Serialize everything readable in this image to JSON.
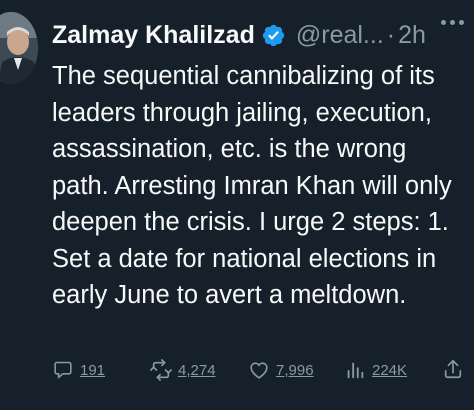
{
  "author": {
    "display_name": "Zalmay Khalilzad",
    "handle": "@real...",
    "separator": "·",
    "time": "2h",
    "verified_icon": "verified-badge-icon"
  },
  "tweet": {
    "text": "The sequential cannibalizing of its leaders through jailing, execution, assassination, etc. is the wrong path. Arresting Imran Khan will only deepen the crisis. I urge 2 steps: 1. Set a date for national elections in early June to avert a meltdown."
  },
  "actions": {
    "replies": "191",
    "retweets": "4,274",
    "likes": "7,996",
    "views": "224K"
  },
  "colors": {
    "background": "#15202b",
    "text": "#f7f9f9",
    "secondary": "#8b98a5",
    "verified": "#1d9bf0"
  }
}
